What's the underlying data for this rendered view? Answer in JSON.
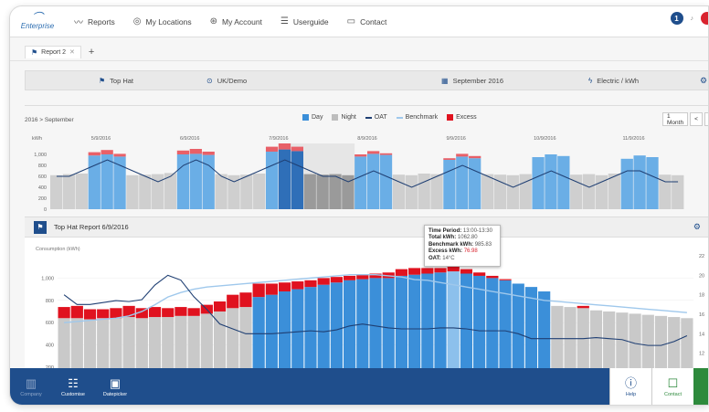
{
  "app": {
    "logo_text": "Enterprise"
  },
  "nav": [
    {
      "label": "Reports",
      "icon": "chart-line-icon"
    },
    {
      "label": "My Locations",
      "icon": "location-pin-icon"
    },
    {
      "label": "My Account",
      "icon": "account-icon"
    },
    {
      "label": "Userguide",
      "icon": "list-icon"
    },
    {
      "label": "Contact",
      "icon": "chat-icon"
    }
  ],
  "notifications": {
    "count": "1"
  },
  "tabs": [
    {
      "label": "Report 2"
    }
  ],
  "filterbar": {
    "chart_type": "Top Hat",
    "location": "UK/Demo",
    "period": "September 2016",
    "units": "Electric / kWh"
  },
  "breadcrumb": "2016 > September",
  "legend": [
    {
      "label": "Day",
      "color": "#3b8fd9"
    },
    {
      "label": "Night",
      "color": "#bdbdbd"
    },
    {
      "label": "OAT",
      "color": "#1f3f73"
    },
    {
      "label": "Benchmark",
      "color": "#9fc8ec"
    },
    {
      "label": "Excess",
      "color": "#e0121f"
    }
  ],
  "controls": {
    "range": "1 Month",
    "prev": "<",
    "next": ">"
  },
  "panel2": {
    "title": "Top Hat Report 6/9/2016",
    "ylabel": "Consumption (kWh)"
  },
  "tooltip": {
    "time_label": "Time Period:",
    "time_value": "13:00-13:30",
    "total_label": "Total kWh:",
    "total_value": "1062.80",
    "bench_label": "Benchmark kWh:",
    "bench_value": "985.83",
    "excess_label": "Excess kWh:",
    "excess_value": "76.98",
    "oat_label": "OAT:",
    "oat_value": "14°C"
  },
  "bottom": [
    {
      "label": "Company",
      "icon": "buildings-icon"
    },
    {
      "label": "Customise",
      "icon": "sliders-icon"
    },
    {
      "label": "Datepicker",
      "icon": "calendar-icon"
    }
  ],
  "bottom_right": [
    {
      "label": "Help",
      "icon": "info-icon"
    },
    {
      "label": "Contact",
      "icon": "chat-bubble-icon"
    }
  ],
  "chart_data": [
    {
      "type": "area",
      "title": "",
      "ylabel": "kWh",
      "ylim": [
        0,
        1200
      ],
      "y_ticks": [
        "1,000",
        "800",
        "600",
        "400",
        "200",
        "0"
      ],
      "date_labels": [
        "5/9/2016",
        "6/9/2016",
        "7/9/2016",
        "8/9/2016",
        "9/9/2016",
        "10/9/2016",
        "11/9/2016"
      ],
      "series": [
        {
          "name": "Day",
          "values": [
            0,
            0,
            0,
            980,
            1000,
            960,
            0,
            0,
            0,
            0,
            1000,
            1010,
            990,
            0,
            0,
            0,
            0,
            1050,
            1090,
            1060,
            0,
            0,
            0,
            0,
            960,
            1010,
            990,
            0,
            0,
            0,
            0,
            900,
            960,
            930,
            0,
            0,
            0,
            0,
            950,
            1000,
            970,
            0,
            0,
            0,
            0,
            920,
            980,
            950,
            0,
            0
          ]
        },
        {
          "name": "Night",
          "values": [
            620,
            640,
            650,
            0,
            0,
            0,
            620,
            630,
            640,
            660,
            0,
            0,
            0,
            640,
            620,
            630,
            650,
            0,
            0,
            0,
            640,
            630,
            640,
            620,
            0,
            0,
            0,
            630,
            620,
            650,
            640,
            0,
            0,
            0,
            640,
            630,
            620,
            640,
            0,
            0,
            0,
            630,
            640,
            620,
            650,
            0,
            0,
            0,
            630,
            620
          ]
        },
        {
          "name": "Excess",
          "values": [
            0,
            0,
            0,
            60,
            80,
            50,
            0,
            0,
            0,
            0,
            70,
            90,
            60,
            0,
            0,
            0,
            0,
            90,
            110,
            80,
            0,
            0,
            0,
            0,
            40,
            50,
            30,
            0,
            0,
            0,
            0,
            30,
            50,
            40,
            0,
            0,
            0,
            0,
            0,
            0,
            0,
            0,
            0,
            0,
            0,
            0,
            0,
            0,
            0,
            0
          ]
        },
        {
          "name": "OAT",
          "values": [
            16,
            16,
            17,
            18,
            19,
            18,
            17,
            16,
            15,
            16,
            18,
            19,
            18,
            16,
            15,
            16,
            17,
            18,
            19,
            18,
            17,
            16,
            16,
            15,
            16,
            17,
            16,
            15,
            14,
            15,
            16,
            17,
            18,
            17,
            16,
            15,
            14,
            15,
            16,
            17,
            16,
            15,
            14,
            15,
            16,
            17,
            17,
            16,
            15,
            15
          ]
        }
      ]
    },
    {
      "type": "bar",
      "title": "Top Hat Report 6/9/2016",
      "ylabel": "Consumption (kWh)",
      "ylim": [
        0,
        1200
      ],
      "y_ticks": [
        "1,000",
        "800",
        "600",
        "400",
        "200"
      ],
      "y2_ticks": [
        "22",
        "20",
        "18",
        "16",
        "14",
        "12",
        "10"
      ],
      "series": [
        {
          "name": "Night",
          "values": [
            640,
            640,
            630,
            640,
            640,
            650,
            640,
            650,
            650,
            660,
            660,
            680,
            700,
            730,
            740,
            0,
            0,
            0,
            0,
            0,
            0,
            0,
            0,
            0,
            0,
            0,
            0,
            0,
            0,
            0,
            0,
            0,
            0,
            0,
            0,
            0,
            0,
            0,
            750,
            740,
            730,
            710,
            700,
            690,
            680,
            670,
            660,
            650,
            640
          ]
        },
        {
          "name": "Day",
          "values": [
            0,
            0,
            0,
            0,
            0,
            0,
            0,
            0,
            0,
            0,
            0,
            0,
            0,
            0,
            0,
            830,
            850,
            880,
            900,
            920,
            940,
            960,
            980,
            990,
            1000,
            1000,
            1020,
            1030,
            1040,
            1050,
            1060,
            1040,
            1020,
            1000,
            980,
            950,
            920,
            880,
            0,
            0,
            0,
            0,
            0,
            0,
            0,
            0,
            0,
            0,
            0
          ]
        },
        {
          "name": "Excess",
          "values": [
            100,
            110,
            90,
            80,
            90,
            100,
            90,
            90,
            80,
            80,
            70,
            80,
            90,
            120,
            130,
            120,
            100,
            80,
            70,
            60,
            60,
            50,
            40,
            40,
            40,
            50,
            60,
            60,
            50,
            40,
            76.98,
            40,
            30,
            20,
            10,
            0,
            0,
            0,
            0,
            0,
            20,
            0,
            0,
            0,
            0,
            0,
            0,
            0,
            0
          ]
        },
        {
          "name": "Benchmark",
          "values": [
            600,
            610,
            620,
            630,
            640,
            660,
            700,
            760,
            830,
            870,
            900,
            920,
            930,
            940,
            950,
            960,
            970,
            980,
            990,
            1000,
            1010,
            1020,
            1030,
            1030,
            1030,
            1020,
            1010,
            985.83,
            980,
            960,
            940,
            920,
            900,
            880,
            860,
            840,
            820,
            800,
            790,
            780,
            770,
            760,
            750,
            740,
            730,
            720,
            710,
            700,
            690
          ]
        },
        {
          "name": "OAT",
          "values": [
            18,
            17,
            17,
            17.2,
            17.4,
            17.3,
            17.5,
            19,
            20,
            19.5,
            17.8,
            16.5,
            15,
            14.5,
            14,
            14,
            14,
            14.1,
            14.2,
            14.3,
            14.2,
            14.4,
            14.8,
            15,
            14.8,
            14.6,
            14.5,
            14.5,
            14.5,
            14.6,
            14.6,
            14.5,
            14.3,
            14.3,
            14.3,
            14,
            13.5,
            13.5,
            13.5,
            13.5,
            13.5,
            13.6,
            13.5,
            13.4,
            13,
            12.8,
            12.8,
            13.2,
            13.8
          ]
        }
      ]
    }
  ]
}
